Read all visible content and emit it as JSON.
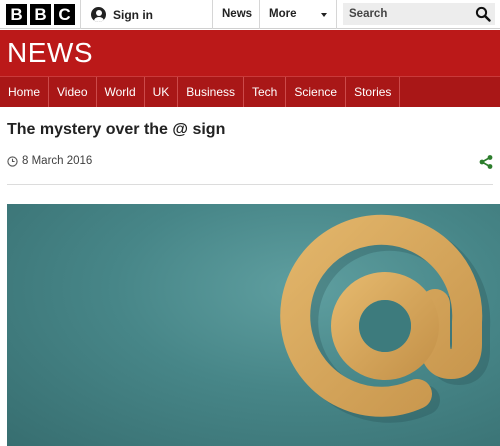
{
  "brand": {
    "logo_letters": [
      "B",
      "B",
      "C"
    ]
  },
  "topbar": {
    "signin_label": "Sign in",
    "links": [
      "News",
      "More"
    ],
    "search_placeholder": "Search"
  },
  "header": {
    "title": "NEWS"
  },
  "nav": {
    "items": [
      "Home",
      "Video",
      "World",
      "UK",
      "Business",
      "Tech",
      "Science",
      "Stories"
    ]
  },
  "article": {
    "headline": "The mystery over the @ sign",
    "date": "8 March 2016"
  },
  "colors": {
    "brand_red": "#bb1919",
    "nav_red": "#a91717",
    "share_green": "#2c7d2c",
    "hero_teal": "#478688",
    "at_sign_gold": "#d3a45a"
  },
  "icons": {
    "signin": "user-icon",
    "more": "chevron-down-icon",
    "search": "search-icon",
    "date": "clock-icon",
    "share": "share-icon"
  }
}
